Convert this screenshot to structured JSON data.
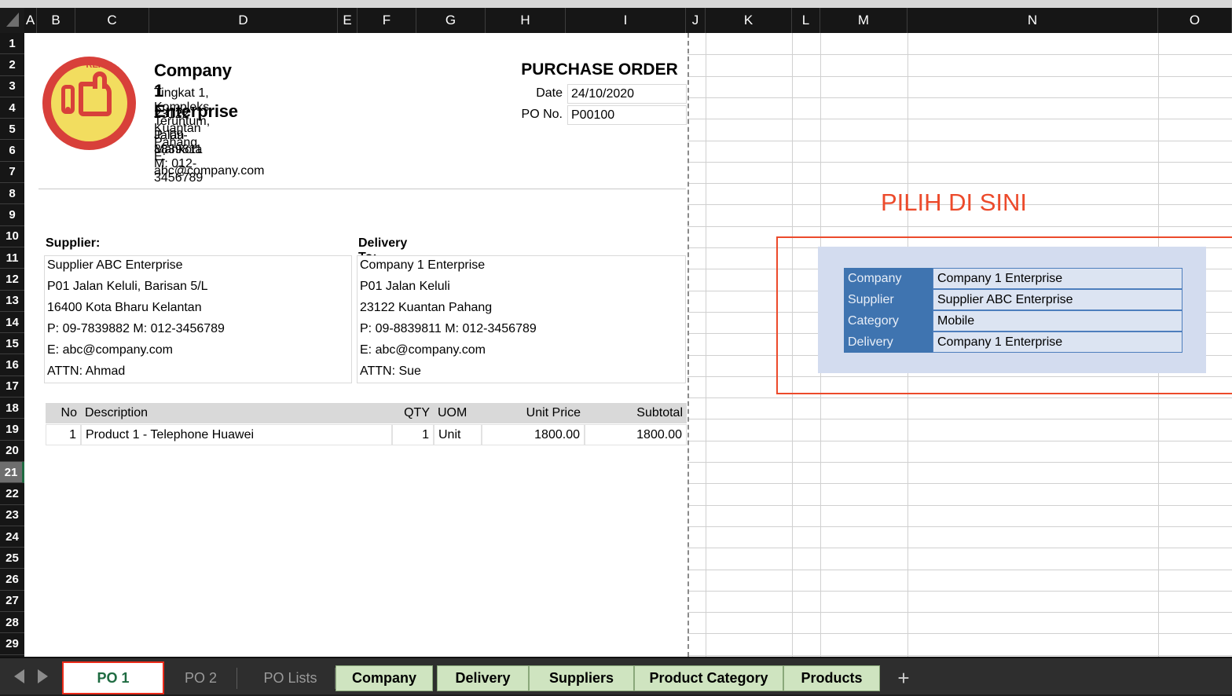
{
  "grid": {
    "columns": [
      "A",
      "B",
      "C",
      "D",
      "E",
      "F",
      "G",
      "H",
      "I",
      "J",
      "K",
      "L",
      "M",
      "N",
      "O"
    ],
    "rows": [
      "1",
      "2",
      "3",
      "4",
      "5",
      "6",
      "7",
      "8",
      "9",
      "10",
      "11",
      "12",
      "13",
      "14",
      "15",
      "16",
      "17",
      "18",
      "19",
      "20",
      "21",
      "22",
      "23",
      "24",
      "25",
      "26",
      "27",
      "28",
      "29"
    ],
    "active_row": "21"
  },
  "document": {
    "company_name": "Company 1 Enterprise",
    "company_address": [
      "Tingkat 1, Kompleks Teruntum, Jalan Mahkota",
      "23122 Kuantan Pahang",
      "P: 09-8839811  M: 012-3456789",
      "E: abc@company.com"
    ],
    "logo_text": "REKEMEN.MY",
    "title": "PURCHASE ORDER",
    "fields": [
      {
        "label": "Date",
        "value": "24/10/2020"
      },
      {
        "label": "PO No.",
        "value": "P00100"
      }
    ],
    "supplier": {
      "heading": "Supplier:",
      "lines": [
        "Supplier ABC Enterprise",
        "P01 Jalan Keluli, Barisan 5/L",
        "16400 Kota Bharu Kelantan",
        "P: 09-7839882  M: 012-3456789",
        "E: abc@company.com",
        "ATTN: Ahmad"
      ]
    },
    "delivery": {
      "heading": "Delivery To:",
      "lines": [
        "Company 1 Enterprise",
        "P01 Jalan Keluli",
        "23122 Kuantan Pahang",
        "P: 09-8839811  M: 012-3456789",
        "E: abc@company.com",
        "ATTN: Sue"
      ]
    },
    "items_table": {
      "headers": [
        "No",
        "Description",
        "QTY",
        "UOM",
        "Unit Price",
        "Subtotal"
      ],
      "rows": [
        {
          "no": "1",
          "description": "Product 1 - Telephone Huawei",
          "qty": "1",
          "uom": "Unit",
          "unit_price": "1800.00",
          "subtotal": "1800.00"
        }
      ]
    }
  },
  "selector": {
    "banner": "PILIH DI SINI",
    "banner_color": "#ec4a2b",
    "rows": [
      {
        "key": "Company",
        "value": "Company 1 Enterprise"
      },
      {
        "key": "Supplier",
        "value": "Supplier ABC Enterprise"
      },
      {
        "key": "Category",
        "value": "Mobile"
      },
      {
        "key": "Delivery",
        "value": "Company 1 Enterprise"
      }
    ]
  },
  "tabs": {
    "items": [
      {
        "label": "PO 1",
        "style": "active"
      },
      {
        "label": "PO 2",
        "style": "plain"
      },
      {
        "label": "PO Lists",
        "style": "plain"
      },
      {
        "label": "Company",
        "style": "green"
      },
      {
        "label": "Delivery",
        "style": "green"
      },
      {
        "label": "Suppliers",
        "style": "green"
      },
      {
        "label": "Product Category",
        "style": "green"
      },
      {
        "label": "Products",
        "style": "green"
      }
    ],
    "add_label": "+"
  }
}
